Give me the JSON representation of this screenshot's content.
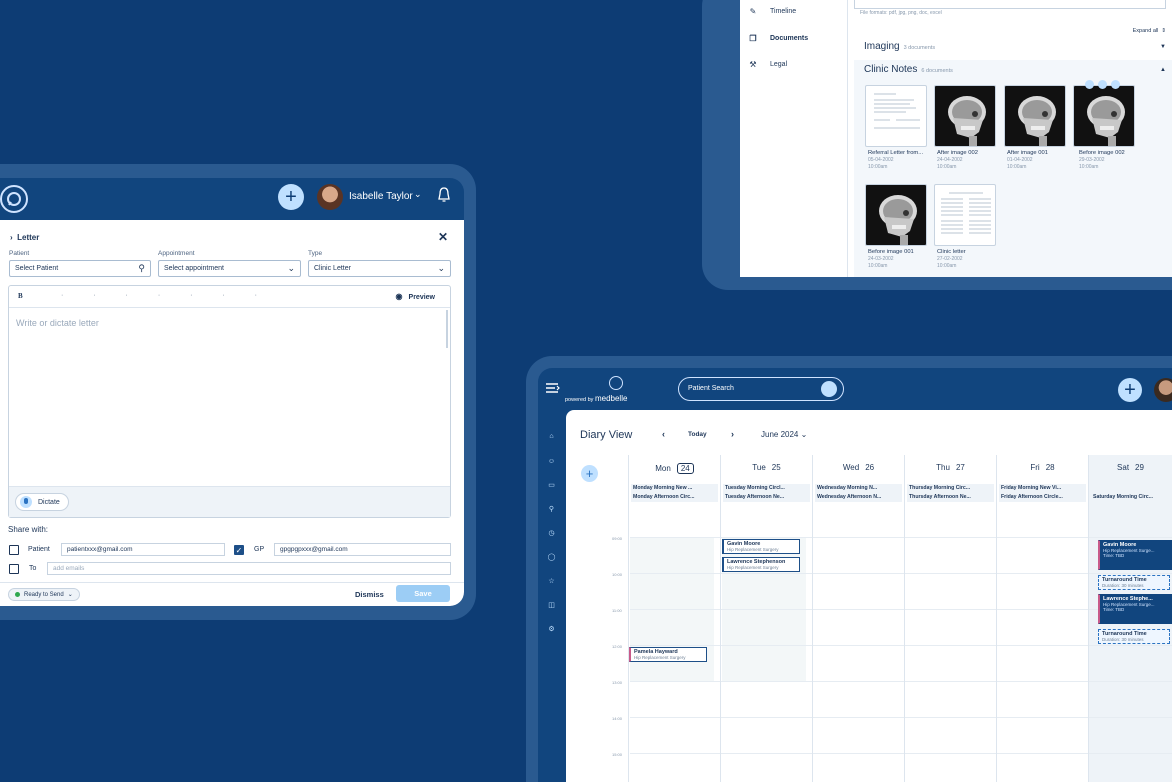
{
  "letter": {
    "user_name": "Isabelle Taylor",
    "title": "Letter",
    "patient_label": "Patient",
    "patient_value": "Select Patient",
    "appointment_label": "Appointment",
    "appointment_value": "Select appointment",
    "type_label": "Type",
    "type_value": "Clinic Letter",
    "bold_btn": "B",
    "preview_label": "Preview",
    "editor_placeholder": "Write or dictate letter",
    "dictate_label": "Dictate",
    "share_with_label": "Share with:",
    "share_patient_label": "Patient",
    "share_patient_email": "patientxxx@gmail.com",
    "share_gp_label": "GP",
    "share_gp_email": "gpgpgpxxx@gmail.com",
    "share_to_label": "To",
    "share_to_placeholder": "add emails",
    "status_label": "Ready to Send",
    "dismiss_label": "Dismiss",
    "save_label": "Save"
  },
  "documents": {
    "sidebar": [
      {
        "label": "Timeline",
        "icon": "pencil-icon"
      },
      {
        "label": "Documents",
        "icon": "documents-icon",
        "active": true
      },
      {
        "label": "Legal",
        "icon": "gavel-icon"
      }
    ],
    "file_formats": "File formats: pdf, jpg, png, doc, excel",
    "expand_all": "Expand all",
    "imaging_title": "Imaging",
    "imaging_count": "3 documents",
    "notes_title": "Clinic Notes",
    "notes_count": "6 documents",
    "items": [
      {
        "name": "Referral Letter from...",
        "date": "05-04-2002",
        "time": "10:00am",
        "kind": "doc"
      },
      {
        "name": "After image 002",
        "date": "24-04-2002",
        "time": "10:00am",
        "kind": "xray"
      },
      {
        "name": "After image 001",
        "date": "01-04-2002",
        "time": "10:00am",
        "kind": "xray"
      },
      {
        "name": "Before image 002",
        "date": "29-03-2002",
        "time": "10:00am",
        "kind": "xray"
      },
      {
        "name": "Before image 001",
        "date": "24-03-2002",
        "time": "10:00am",
        "kind": "xray"
      },
      {
        "name": "Clinic letter",
        "date": "27-02-2002",
        "time": "10:00am",
        "kind": "doc"
      }
    ]
  },
  "diary": {
    "powered_by": "powered by",
    "brand": "medbelle",
    "search_placeholder": "Patient Search",
    "title": "Diary View",
    "today_label": "Today",
    "month_label": "June 2024",
    "days": [
      {
        "name": "Mon",
        "num": "24",
        "today": true,
        "s1": "Monday Morning New ...",
        "s2": "Monday Afternoon Circ..."
      },
      {
        "name": "Tue",
        "num": "25",
        "s1": "Tuesday Morning Circl...",
        "s2": "Tuesday Afternoon Ne..."
      },
      {
        "name": "Wed",
        "num": "26",
        "s1": "Wednesday Morning N...",
        "s2": "Wednesday Afternoon N..."
      },
      {
        "name": "Thu",
        "num": "27",
        "s1": "Thursday Morning Circ...",
        "s2": "Thursday Afternoon Ne..."
      },
      {
        "name": "Fri",
        "num": "28",
        "s1": "Friday Morning New Vi...",
        "s2": "Friday Afternoon Circle..."
      },
      {
        "name": "Sat",
        "num": "29",
        "s1": "Saturday Morning Circ..."
      }
    ],
    "appointments": {
      "a1_name": "Gavin Moore",
      "a1_sub": "Hip Replacement Surgery",
      "a2_name": "Lawrence Stephenson",
      "a2_sub": "Hip Replacement Surgery",
      "a3_name": "Pamela Hayward",
      "a3_sub": "Hip Replacement Surgery",
      "s1_name": "Gavin Moore",
      "s1_sub": "Hip Replacement Surge...",
      "s1_time": "Time: TBD",
      "t1_name": "Turnaround Time",
      "t1_sub": "Duration: 30 minutes",
      "s2_name": "Lawrence Stephe...",
      "s2_sub": "Hip Replacement Surge...",
      "s2_time": "Time: TBD",
      "t2_name": "Turnaround Time",
      "t2_sub": "Duration: 30 minutes"
    }
  }
}
